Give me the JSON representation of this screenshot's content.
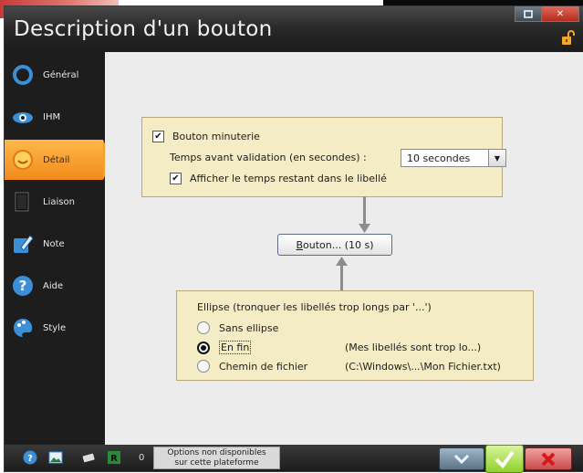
{
  "window": {
    "title": "Description d'un bouton"
  },
  "sidebar": {
    "items": [
      {
        "label": "Général",
        "icon": "circle-icon",
        "active": false
      },
      {
        "label": "IHM",
        "icon": "eye-icon",
        "active": false
      },
      {
        "label": "Détail",
        "icon": "smiley-icon",
        "active": true
      },
      {
        "label": "Liaison",
        "icon": "document-icon",
        "active": false
      },
      {
        "label": "Note",
        "icon": "pencil-note-icon",
        "active": false
      },
      {
        "label": "Aide",
        "icon": "question-icon",
        "active": false
      },
      {
        "label": "Style",
        "icon": "palette-icon",
        "active": false
      }
    ]
  },
  "timer_group": {
    "timer_checkbox_label": "Bouton minuterie",
    "timer_checked": true,
    "delay_label": "Temps avant validation (en secondes) :",
    "delay_value": "10 secondes",
    "show_remaining_label": "Afficher le temps restant dans le libellé",
    "show_remaining_checked": true
  },
  "preview": {
    "button_label_underlined": "B",
    "button_label_rest": "outon... (10 s)"
  },
  "ellipsis_group": {
    "title": "Ellipse (tronquer les libellés trop longs par '...')",
    "options": [
      {
        "label": "Sans ellipse",
        "example": "",
        "selected": false
      },
      {
        "label": "En fin",
        "example": "(Mes libellés sont trop lo...)",
        "selected": true
      },
      {
        "label": "Chemin de fichier",
        "example": "(C:\\Windows\\...\\Mon Fichier.txt)",
        "selected": false
      }
    ]
  },
  "bottombar": {
    "count": "0",
    "note_line1": "Options non disponibles",
    "note_line2": "sur cette plateforme"
  },
  "colors": {
    "accent_orange": "#f4a030",
    "group_fill": "#f3ecc4",
    "ok_green": "#8fd12e",
    "cancel_red": "#c94b4b"
  }
}
